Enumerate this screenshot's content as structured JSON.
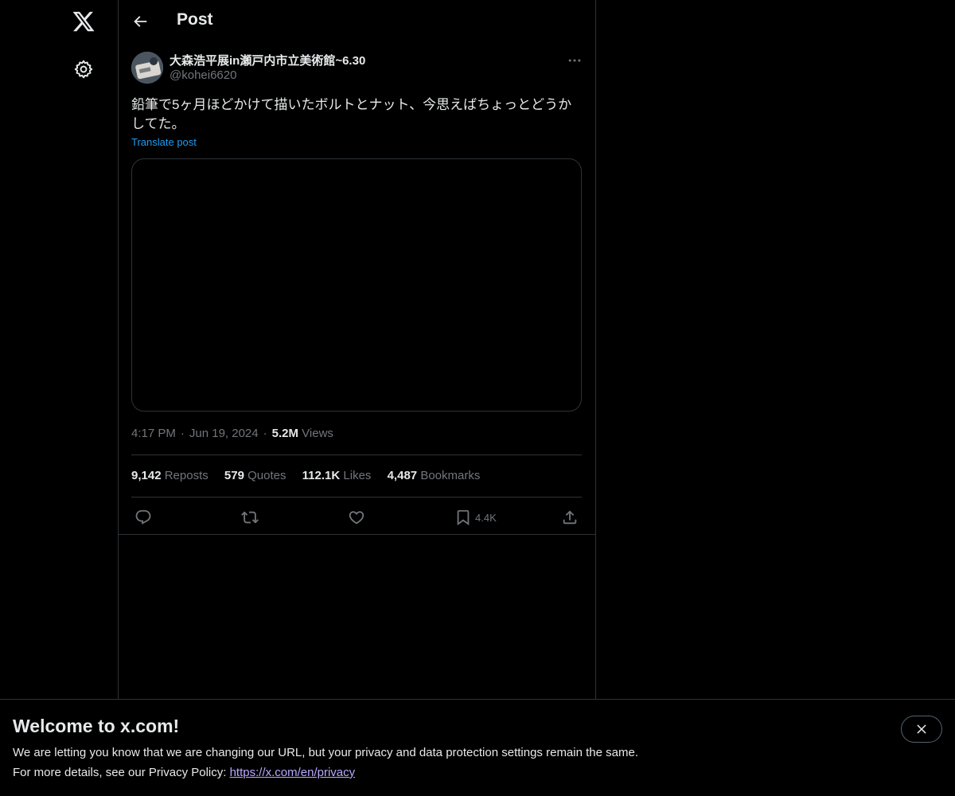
{
  "colors": {
    "background": "#000000",
    "text": "#e7e9ea",
    "muted": "#71767b",
    "link": "#1d9bf0",
    "border": "#2f3336",
    "banner_link": "#b9a8ff"
  },
  "nav": {
    "logo_icon": "x-logo-icon",
    "settings_icon": "gear-icon"
  },
  "header": {
    "title": "Post",
    "back_icon": "arrow-left-icon"
  },
  "post": {
    "author_name": "大森浩平展in瀬戸内市立美術館~6.30",
    "author_handle": "@kohei6620",
    "text": "鉛筆で5ヶ月ほどかけて描いたボルトとナット、今思えばちょっとどうかしてた。",
    "translate_label": "Translate post",
    "time": "4:17 PM",
    "date": "Jun 19, 2024",
    "views_count": "5.2M",
    "views_label": "Views",
    "stats": {
      "reposts_count": "9,142",
      "reposts_label": "Reposts",
      "quotes_count": "579",
      "quotes_label": "Quotes",
      "likes_count": "112.1K",
      "likes_label": "Likes",
      "bookmarks_count": "4,487",
      "bookmarks_label": "Bookmarks"
    },
    "actions": {
      "reply_icon": "reply-icon",
      "repost_icon": "repost-icon",
      "like_icon": "heart-icon",
      "bookmark_icon": "bookmark-icon",
      "bookmark_count": "4.4K",
      "share_icon": "share-icon"
    }
  },
  "banner": {
    "title": "Welcome to x.com!",
    "line1": "We are letting you know that we are changing our URL, but your privacy and data protection settings remain the same.",
    "line2_prefix": "For more details, see our Privacy Policy: ",
    "link_text": "https://x.com/en/privacy",
    "close_icon": "close-icon"
  }
}
